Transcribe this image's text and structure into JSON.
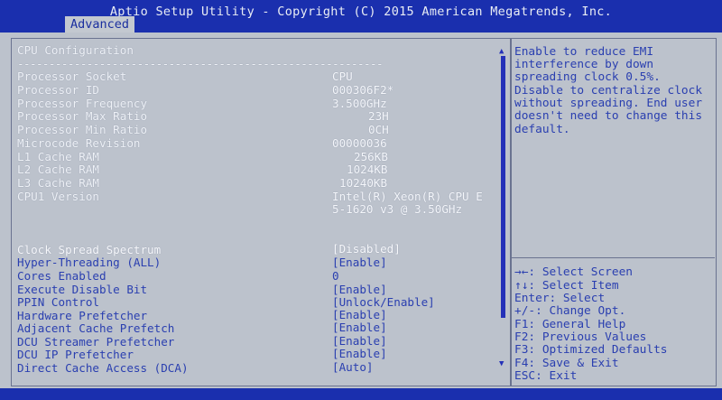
{
  "header": {
    "title": "Aptio Setup Utility - Copyright (C) 2015 American Megatrends, Inc.",
    "tab_advanced": "Advanced"
  },
  "page_title": "CPU Configuration",
  "divider": "----------------------------------------------------------",
  "info_rows": [
    {
      "label": "Processor Socket",
      "value": "CPU"
    },
    {
      "label": "Processor ID",
      "value": "000306F2*"
    },
    {
      "label": "Processor Frequency",
      "value": "3.500GHz"
    },
    {
      "label": "Processor Max Ratio",
      "value": "23H"
    },
    {
      "label": "Processor Min Ratio",
      "value": "0CH"
    },
    {
      "label": "Microcode Revision",
      "value": "00000036"
    },
    {
      "label": "L1 Cache RAM",
      "value": "256KB"
    },
    {
      "label": "L2 Cache RAM",
      "value": "1024KB"
    },
    {
      "label": "L3 Cache RAM",
      "value": "10240KB"
    },
    {
      "label": "CPU1 Version",
      "value": "Intel(R) Xeon(R) CPU E"
    }
  ],
  "cpu_version_line2": "5-1620 v3 @ 3.50GHz",
  "settings": [
    {
      "label": "Clock Spread Spectrum",
      "value": "[Disabled]"
    },
    {
      "label": "Hyper-Threading (ALL)",
      "value": "[Enable]"
    },
    {
      "label": "Cores Enabled",
      "value": "0"
    },
    {
      "label": "Execute Disable Bit",
      "value": "[Enable]"
    },
    {
      "label": "PPIN Control",
      "value": "[Unlock/Enable]"
    },
    {
      "label": "Hardware Prefetcher",
      "value": "[Enable]"
    },
    {
      "label": "Adjacent Cache Prefetch",
      "value": "[Enable]"
    },
    {
      "label": "DCU Streamer Prefetcher",
      "value": "[Enable]"
    },
    {
      "label": "DCU IP Prefetcher",
      "value": "[Enable]"
    },
    {
      "label": "Direct Cache Access (DCA)",
      "value": "[Auto]"
    }
  ],
  "help_text": [
    "Enable to reduce EMI",
    "interference by down",
    "spreading clock 0.5%.",
    "Disable to centralize clock",
    "without spreading. End user",
    "doesn't need to change this",
    "default."
  ],
  "key_legend": [
    "→←: Select Screen",
    "↑↓: Select Item",
    "Enter: Select",
    "+/-: Change Opt.",
    "F1: General Help",
    "F2: Previous Values",
    "F3: Optimized Defaults",
    "F4: Save & Exit",
    "ESC: Exit"
  ],
  "scroll_arrows": {
    "up": "▲",
    "down": "▼"
  },
  "colors": {
    "bar": "#1a2fae",
    "panel": "#bcc2cc",
    "label_blue": "#2a3fb0",
    "value_white": "#f4f6fa"
  }
}
